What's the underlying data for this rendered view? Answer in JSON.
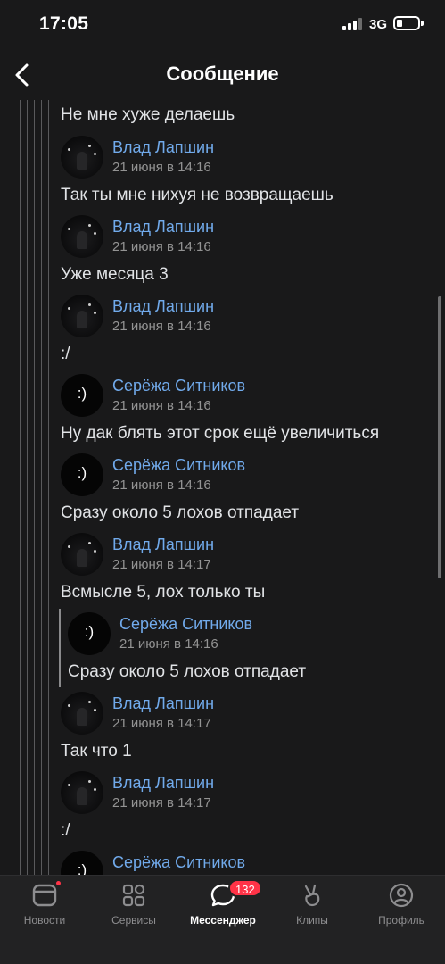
{
  "status_bar": {
    "time": "17:05",
    "network": "3G"
  },
  "header": {
    "title": "Сообщение"
  },
  "thread": [
    {
      "text": "Не мне хуже делаешь"
    },
    {
      "author": "Влад Лапшин",
      "date": "21 июня в 14:16",
      "avatar": "vlad",
      "text": "Так ты мне нихуя не возвращаешь"
    },
    {
      "author": "Влад Лапшин",
      "date": "21 июня в 14:16",
      "avatar": "vlad",
      "text": "Уже месяца 3"
    },
    {
      "author": "Влад Лапшин",
      "date": "21 июня в 14:16",
      "avatar": "vlad",
      "text": ":/"
    },
    {
      "author": "Серёжа Ситников",
      "date": "21 июня в 14:16",
      "avatar": "smile",
      "text": "Ну дак блять этот срок ещё увеличиться"
    },
    {
      "author": "Серёжа Ситников",
      "date": "21 июня в 14:16",
      "avatar": "smile",
      "text": "Сразу около 5 лохов отпадает"
    },
    {
      "author": "Влад Лапшин",
      "date": "21 июня в 14:17",
      "avatar": "vlad",
      "text": "Всмысле 5, лох только ты"
    },
    {
      "author": "Серёжа Ситников",
      "date": "21 июня в 14:16",
      "avatar": "smile",
      "text": "Сразу около 5 лохов отпадает",
      "quoted": true
    },
    {
      "author": "Влад Лапшин",
      "date": "21 июня в 14:17",
      "avatar": "vlad",
      "text": "Так что 1"
    },
    {
      "author": "Влад Лапшин",
      "date": "21 июня в 14:17",
      "avatar": "vlad",
      "text": ":/"
    },
    {
      "author": "Серёжа Ситников",
      "avatar": "smile"
    }
  ],
  "avatar_smile_text": ":)",
  "tabbar": {
    "tabs": [
      {
        "label": "Новости",
        "icon": "news-icon"
      },
      {
        "label": "Сервисы",
        "icon": "services-icon"
      },
      {
        "label": "Мессенджер",
        "icon": "messenger-icon",
        "badge": "132",
        "active": true
      },
      {
        "label": "Клипы",
        "icon": "clips-icon"
      },
      {
        "label": "Профиль",
        "icon": "profile-icon"
      }
    ]
  },
  "colors": {
    "background": "#19191a",
    "link": "#71aaeb",
    "badge": "#ff3347"
  }
}
